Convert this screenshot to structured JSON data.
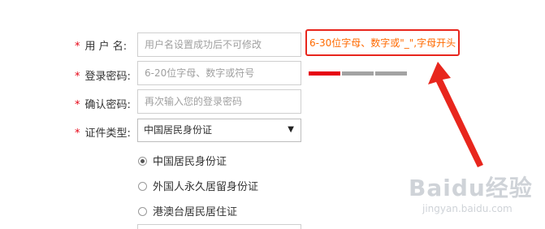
{
  "form": {
    "username": {
      "label": "用 户 名:",
      "placeholder": "用户名设置成功后不可修改"
    },
    "password": {
      "label": "登录密码:",
      "placeholder": "6-20位字母、数字或符号"
    },
    "confirm": {
      "label": "确认密码:",
      "placeholder": "再次输入您的登录密码"
    },
    "id_type": {
      "label": "证件类型:",
      "selected": "中国居民身份证"
    },
    "required_mark": "*",
    "id_options": [
      {
        "label": "中国居民身份证",
        "checked": true
      },
      {
        "label": "外国人永久居留身份证",
        "checked": false
      },
      {
        "label": "港澳台居民居住证",
        "checked": false
      }
    ]
  },
  "hint": {
    "text": "6-30位字母、数字或\"_\",字母开头"
  },
  "password_strength": {
    "segments": 3,
    "active": 1
  },
  "watermark": {
    "brand": "Baidu经验",
    "url": "jingyan.baidu.com"
  },
  "colors": {
    "required": "#e60012",
    "hint_text": "#ff6a00",
    "hint_border": "#e8261d",
    "strength_active": "#e60012",
    "strength_inactive": "#a3a3a3"
  }
}
